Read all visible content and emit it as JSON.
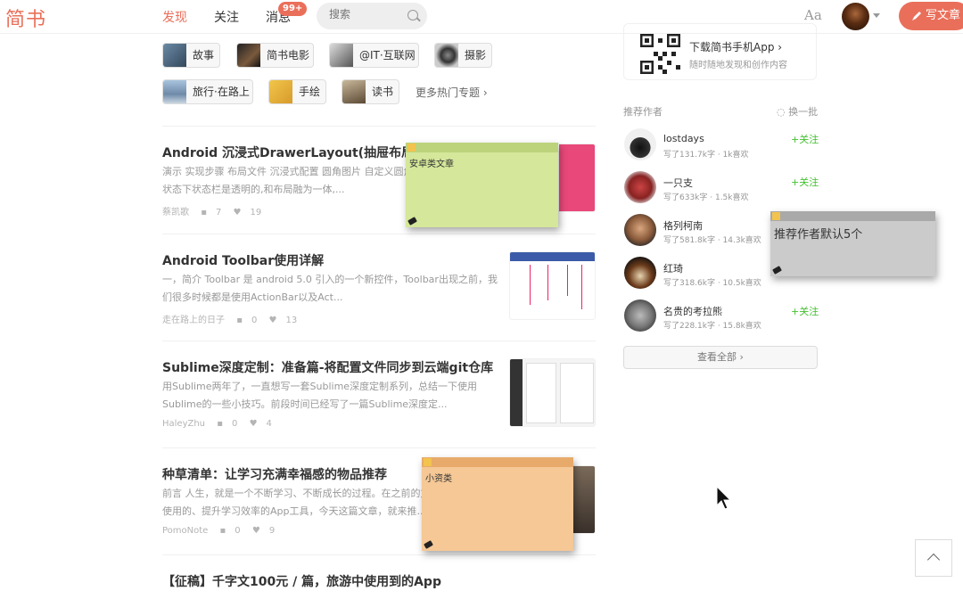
{
  "header": {
    "logo": "简书",
    "nav": [
      {
        "label": "发现",
        "active": true
      },
      {
        "label": "关注",
        "active": false
      },
      {
        "label": "消息",
        "active": false
      }
    ],
    "notification_badge": "99+",
    "search_placeholder": "搜索",
    "font_toggle": "Aa",
    "write_button": "写文章"
  },
  "topics": [
    {
      "label": "故事"
    },
    {
      "label": "简书电影"
    },
    {
      "label": "@IT·互联网"
    },
    {
      "label": "摄影"
    },
    {
      "label": "旅行·在路上"
    },
    {
      "label": "手绘"
    },
    {
      "label": "读书"
    }
  ],
  "more_topics": "更多热门专题 ›",
  "articles": [
    {
      "title": "Android 沉浸式DrawerLayout(抽屉布局)案",
      "abstract": "演示 实现步骤 布局文件 沉浸式配置 圆角图片 自定义圆角属性... 情况下,沉浸状态下状态栏是透明的,和布局融为一体,...",
      "author": "蔡凯歌",
      "comments": "7",
      "likes": "19"
    },
    {
      "title": "Android Toolbar使用详解",
      "abstract": "一，简介 Toolbar 是 android 5.0 引入的一个新控件，Toolbar出现之前，我们很多时候都是使用ActionBar以及Act...",
      "author": "走在路上的日子",
      "comments": "0",
      "likes": "13"
    },
    {
      "title": "Sublime深度定制：准备篇-将配置文件同步到云端git仓库",
      "abstract": "用Sublime两年了，一直想写一套Sublime深度定制系列，总结一下使用Sublime的一些小技巧。前段时间已经写了一篇Sublime深度定...",
      "author": "HaleyZhu",
      "comments": "0",
      "likes": "4"
    },
    {
      "title": "种草清单：让学习充满幸福感的物品推荐",
      "abstract": "前言 人生，就是一个不断学习、不断成长的过程。在之前的文章中... 些自己使用的、提升学习效率的App工具，今天这篇文章，就来推...",
      "author": "PomoNote",
      "comments": "0",
      "likes": "9"
    },
    {
      "title": "【征稿】千字文100元 / 篇，旅游中使用到的App",
      "abstract": "",
      "author": "",
      "comments": "",
      "likes": ""
    }
  ],
  "stickies": [
    {
      "text": "安卓类文章",
      "color": "#d4e79a"
    },
    {
      "text": "推荐作者默认5个",
      "color": "#cbcbcb"
    },
    {
      "text": "小资类",
      "color": "#f5c896"
    }
  ],
  "app_card": {
    "title": "下载简书手机App ›",
    "subtitle": "随时随地发现和创作内容"
  },
  "recommend": {
    "heading": "推荐作者",
    "refresh": "换一批",
    "follow_label": "+关注",
    "see_all": "查看全部 ›",
    "authors": [
      {
        "name": "lostdays",
        "desc": "写了131.7k字 · 1k喜欢"
      },
      {
        "name": "一只支",
        "desc": "写了633k字 · 1.5k喜欢"
      },
      {
        "name": "格列柯南",
        "desc": "写了581.8k字 · 14.3k喜欢"
      },
      {
        "name": "红琦",
        "desc": "写了318.6k字 · 10.5k喜欢"
      },
      {
        "name": "名贵的考拉熊",
        "desc": "写了228.1k字 · 15.8k喜欢"
      }
    ]
  },
  "colors": {
    "brand": "#ea6f5a",
    "follow": "#42c02e"
  }
}
